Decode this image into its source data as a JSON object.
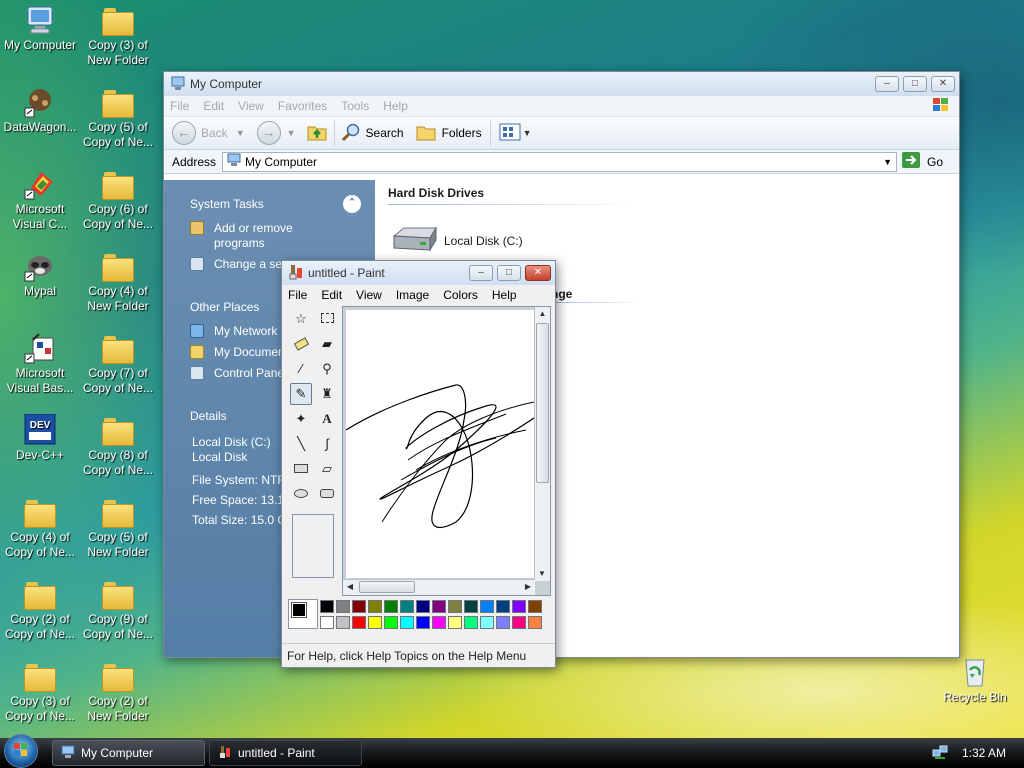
{
  "desktop": {
    "icons": [
      {
        "label": "My Computer",
        "kind": "computer"
      },
      {
        "label": "Copy (3) of New Folder",
        "kind": "folder"
      },
      {
        "label": "DataWagon...",
        "kind": "app"
      },
      {
        "label": "Copy (5) of Copy of Ne...",
        "kind": "folder"
      },
      {
        "label": "Microsoft Visual C...",
        "kind": "app"
      },
      {
        "label": "Copy (6) of Copy of Ne...",
        "kind": "folder"
      },
      {
        "label": "Mypal",
        "kind": "app"
      },
      {
        "label": "Copy (4) of New Folder",
        "kind": "folder"
      },
      {
        "label": "Microsoft Visual Bas...",
        "kind": "app"
      },
      {
        "label": "Copy (7) of Copy of Ne...",
        "kind": "folder"
      },
      {
        "label": "Dev-C++",
        "kind": "app"
      },
      {
        "label": "Copy (8) of Copy of Ne...",
        "kind": "folder"
      },
      {
        "label": "Copy (4) of Copy of Ne...",
        "kind": "folder"
      },
      {
        "label": "Copy (5) of New Folder",
        "kind": "folder"
      },
      {
        "label": "Copy (2) of Copy of Ne...",
        "kind": "folder"
      },
      {
        "label": "Copy (9) of Copy of Ne...",
        "kind": "folder"
      },
      {
        "label": "Copy (3) of Copy of Ne...",
        "kind": "folder"
      },
      {
        "label": "Copy (2) of New Folder",
        "kind": "folder"
      },
      {
        "label": "Recycle Bin",
        "kind": "recycle-bin"
      }
    ]
  },
  "explorer": {
    "title": "My Computer",
    "menu": [
      "File",
      "Edit",
      "View",
      "Favorites",
      "Tools",
      "Help"
    ],
    "toolbar": {
      "back": "Back",
      "search": "Search",
      "folders": "Folders"
    },
    "address": {
      "label": "Address",
      "value": "My Computer",
      "go": "Go"
    },
    "system_tasks": {
      "title": "System Tasks",
      "items": [
        "Add or remove programs",
        "Change a set"
      ]
    },
    "other_places": {
      "title": "Other Places",
      "items": [
        "My Network",
        "My Documen",
        "Control Pane"
      ]
    },
    "details": {
      "title": "Details",
      "name": "Local Disk (C:)",
      "type": "Local Disk",
      "file_system": "File System: NTFS",
      "free_space": "Free Space: 13.1 G",
      "total_size": "Total Size: 15.0 GB"
    },
    "content": {
      "section_hard_disks": "Hard Disk Drives",
      "drive_label": "Local Disk (C:)",
      "section_partial": "nge"
    }
  },
  "paint": {
    "title": "untitled - Paint",
    "menu": [
      "File",
      "Edit",
      "View",
      "Image",
      "Colors",
      "Help"
    ],
    "status": "For Help, click Help Topics on the Help Menu",
    "palette_top": [
      "#000000",
      "#808080",
      "#800000",
      "#808000",
      "#008000",
      "#008080",
      "#000080",
      "#800080",
      "#808040",
      "#004040",
      "#0080ff",
      "#004080",
      "#8000ff",
      "#804000"
    ],
    "palette_bottom": [
      "#ffffff",
      "#c0c0c0",
      "#ff0000",
      "#ffff00",
      "#00ff00",
      "#00ffff",
      "#0000ff",
      "#ff00ff",
      "#ffff80",
      "#00ff80",
      "#80ffff",
      "#8080ff",
      "#ff0080",
      "#ff8040"
    ]
  },
  "taskbar": {
    "items": [
      "My Computer",
      "untitled - Paint"
    ],
    "clock": "1:32 AM"
  }
}
